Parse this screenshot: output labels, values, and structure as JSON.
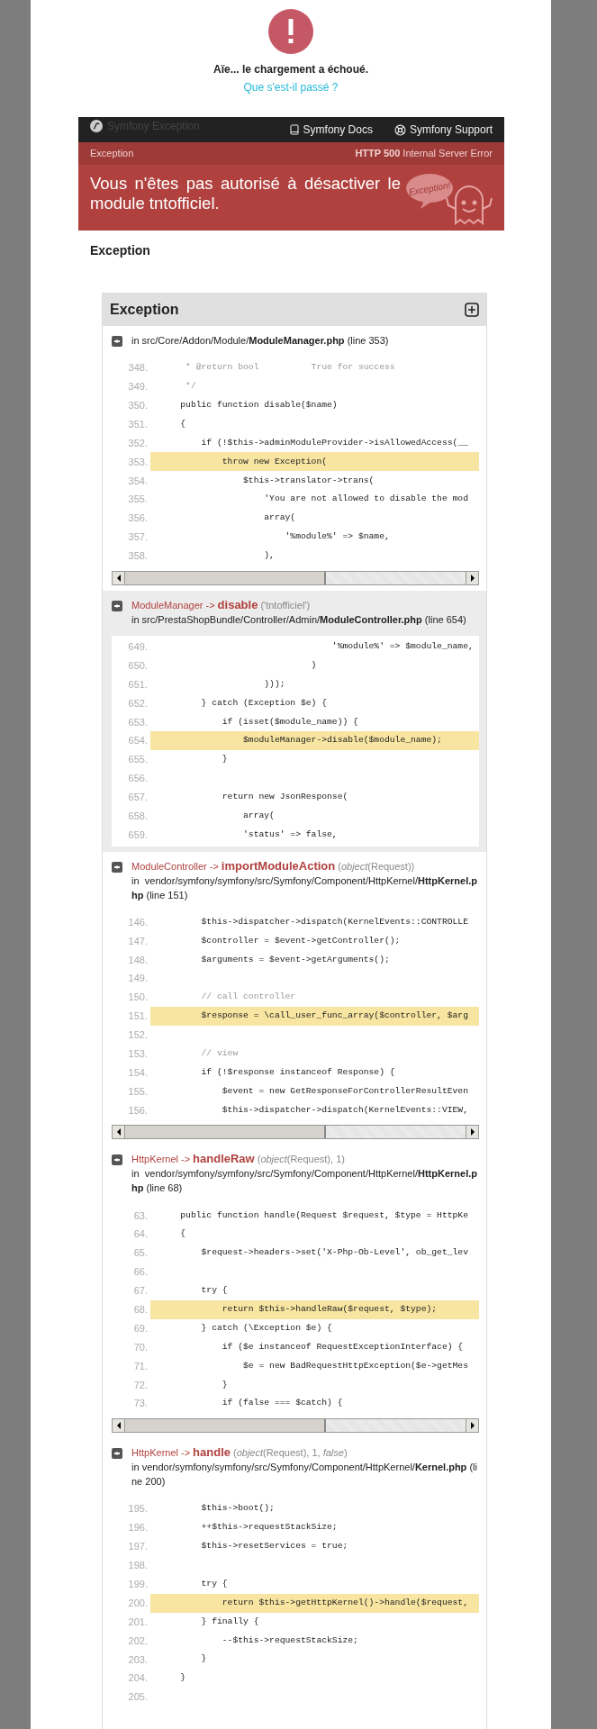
{
  "loading_error": {
    "title": "Aïe... le chargement a échoué.",
    "link": "Que s'est-il passé ?"
  },
  "symfony_header": {
    "brand": "Symfony Exception",
    "links": [
      "Symfony Docs",
      "Symfony Support"
    ]
  },
  "exception_bar": {
    "label": "Exception",
    "status_code": "HTTP 500",
    "status_text": "Internal Server Error"
  },
  "message": "Vous n'êtes pas autorisé à désactiver le module tntofficiel.",
  "bubble_text": "Exception!",
  "section_title": "Exception",
  "trace_panel": {
    "title": "Exception",
    "traces": [
      {
        "file": "in src/Core/Addon/Module/**ModuleManager.php** (line 353)",
        "highlighted": false,
        "scrollbar": true,
        "lines": [
          {
            "no": "348.",
            "kind": "comment",
            "highlighted": false,
            "code": "     * @return bool          True for success"
          },
          {
            "no": "349.",
            "kind": "comment",
            "highlighted": false,
            "code": "     */"
          },
          {
            "no": "350.",
            "kind": "code",
            "highlighted": false,
            "code": "    public function disable($name)"
          },
          {
            "no": "351.",
            "kind": "code",
            "highlighted": false,
            "code": "    {"
          },
          {
            "no": "352.",
            "kind": "code",
            "highlighted": false,
            "code": "        if (!$this->adminModuleProvider->isAllowedAccess(__"
          },
          {
            "no": "353.",
            "kind": "code",
            "highlighted": true,
            "code": "            throw new Exception("
          },
          {
            "no": "354.",
            "kind": "code",
            "highlighted": false,
            "code": "                $this->translator->trans("
          },
          {
            "no": "355.",
            "kind": "code",
            "highlighted": false,
            "code": "                    'You are not allowed to disable the mod"
          },
          {
            "no": "356.",
            "kind": "code",
            "highlighted": false,
            "code": "                    array("
          },
          {
            "no": "357.",
            "kind": "code",
            "highlighted": false,
            "code": "                        '%module%' => $name,"
          },
          {
            "no": "358.",
            "kind": "code",
            "highlighted": false,
            "code": "                    ),"
          }
        ]
      },
      {
        "class": "ModuleManager",
        "arrow": "->",
        "method": "disable",
        "args": "('tntofficiel')",
        "file": "in src/PrestaShopBundle/Controller/Admin/**ModuleController.php** (line 654)",
        "highlighted": true,
        "scrollbar": false,
        "lines": [
          {
            "no": "649.",
            "kind": "code",
            "highlighted": false,
            "code": "                                 '%module%' => $module_name,"
          },
          {
            "no": "650.",
            "kind": "code",
            "highlighted": false,
            "code": "                             )"
          },
          {
            "no": "651.",
            "kind": "code",
            "highlighted": false,
            "code": "                    )));"
          },
          {
            "no": "652.",
            "kind": "code",
            "highlighted": false,
            "code": "        } catch (Exception $e) {"
          },
          {
            "no": "653.",
            "kind": "code",
            "highlighted": false,
            "code": "            if (isset($module_name)) {"
          },
          {
            "no": "654.",
            "kind": "code",
            "highlighted": true,
            "code": "                $moduleManager->disable($module_name);"
          },
          {
            "no": "655.",
            "kind": "code",
            "highlighted": false,
            "code": "            }"
          },
          {
            "no": "656.",
            "highlighted": false
          },
          {
            "no": "657.",
            "kind": "code",
            "highlighted": false,
            "code": "            return new JsonResponse("
          },
          {
            "no": "658.",
            "kind": "code",
            "highlighted": false,
            "code": "                array("
          },
          {
            "no": "659.",
            "kind": "code",
            "highlighted": false,
            "code": "                'status' => false,"
          }
        ]
      },
      {
        "class": "ModuleController",
        "arrow": "->",
        "method": "importModuleAction",
        "args": "(*object*(Request))",
        "file": "in vendor/symfony/symfony/src/Symfony/Component/HttpKernel/**HttpKernel.php** (line 151)",
        "highlighted": false,
        "scrollbar": true,
        "lines": [
          {
            "no": "146.",
            "kind": "code",
            "highlighted": false,
            "code": "        $this->dispatcher->dispatch(KernelEvents::CONTROLLE"
          },
          {
            "no": "147.",
            "kind": "code",
            "highlighted": false,
            "code": "        $controller = $event->getController();"
          },
          {
            "no": "148.",
            "kind": "code",
            "highlighted": false,
            "code": "        $arguments = $event->getArguments();"
          },
          {
            "no": "149.",
            "highlighted": false
          },
          {
            "no": "150.",
            "kind": "comment",
            "highlighted": false,
            "code": "        // call controller"
          },
          {
            "no": "151.",
            "kind": "code",
            "highlighted": true,
            "code": "        $response = \\call_user_func_array($controller, $arg"
          },
          {
            "no": "152.",
            "highlighted": false
          },
          {
            "no": "153.",
            "kind": "comment",
            "highlighted": false,
            "code": "        // view"
          },
          {
            "no": "154.",
            "kind": "code",
            "highlighted": false,
            "code": "        if (!$response instanceof Response) {"
          },
          {
            "no": "155.",
            "kind": "code",
            "highlighted": false,
            "code": "            $event = new GetResponseForControllerResultEven"
          },
          {
            "no": "156.",
            "kind": "code",
            "highlighted": false,
            "code": "            $this->dispatcher->dispatch(KernelEvents::VIEW,"
          }
        ]
      },
      {
        "class": "HttpKernel",
        "arrow": "->",
        "method": "handleRaw",
        "args": "(*object*(Request), 1)",
        "file": "in vendor/symfony/symfony/src/Symfony/Component/HttpKernel/**HttpKernel.php** (line 68)",
        "highlighted": false,
        "scrollbar": true,
        "lines": [
          {
            "no": "63.",
            "kind": "code",
            "highlighted": false,
            "code": "    public function handle(Request $request, $type = HttpKe"
          },
          {
            "no": "64.",
            "kind": "code",
            "highlighted": false,
            "code": "    {"
          },
          {
            "no": "65.",
            "kind": "code",
            "highlighted": false,
            "code": "        $request->headers->set('X-Php-Ob-Level', ob_get_lev"
          },
          {
            "no": "66.",
            "highlighted": false
          },
          {
            "no": "67.",
            "kind": "code",
            "highlighted": false,
            "code": "        try {"
          },
          {
            "no": "68.",
            "kind": "code",
            "highlighted": true,
            "code": "            return $this->handleRaw($request, $type);"
          },
          {
            "no": "69.",
            "kind": "code",
            "highlighted": false,
            "code": "        } catch (\\Exception $e) {"
          },
          {
            "no": "70.",
            "kind": "code",
            "highlighted": false,
            "code": "            if ($e instanceof RequestExceptionInterface) {"
          },
          {
            "no": "71.",
            "kind": "code",
            "highlighted": false,
            "code": "                $e = new BadRequestHttpException($e->getMes"
          },
          {
            "no": "72.",
            "kind": "code",
            "highlighted": false,
            "code": "            }"
          },
          {
            "no": "73.",
            "kind": "code",
            "highlighted": false,
            "code": "            if (false === $catch) {"
          }
        ]
      },
      {
        "class": "HttpKernel",
        "arrow": "->",
        "method": "handle",
        "args": "(*object*(Request), 1, *false*)",
        "file": "in vendor/symfony/symfony/src/Symfony/Component/HttpKernel/**Kernel.php** (line 200)",
        "highlighted": false,
        "scrollbar": false,
        "lines": [
          {
            "no": "195.",
            "kind": "code",
            "highlighted": false,
            "code": "        $this->boot();"
          },
          {
            "no": "196.",
            "kind": "code",
            "highlighted": false,
            "code": "        ++$this->requestStackSize;"
          },
          {
            "no": "197.",
            "kind": "code",
            "highlighted": false,
            "code": "        $this->resetServices = true;"
          },
          {
            "no": "198.",
            "highlighted": false
          },
          {
            "no": "199.",
            "kind": "code",
            "highlighted": false,
            "code": "        try {"
          },
          {
            "no": "200.",
            "kind": "code",
            "highlighted": true,
            "code": "            return $this->getHttpKernel()->handle($request,"
          },
          {
            "no": "201.",
            "kind": "code",
            "highlighted": false,
            "code": "        } finally {"
          },
          {
            "no": "202.",
            "kind": "code",
            "highlighted": false,
            "code": "            --$this->requestStackSize;"
          },
          {
            "no": "203.",
            "kind": "code",
            "highlighted": false,
            "code": "        }"
          },
          {
            "no": "204.",
            "kind": "code",
            "highlighted": false,
            "code": "    }"
          },
          {
            "no": "205.",
            "highlighted": false
          }
        ]
      }
    ]
  }
}
